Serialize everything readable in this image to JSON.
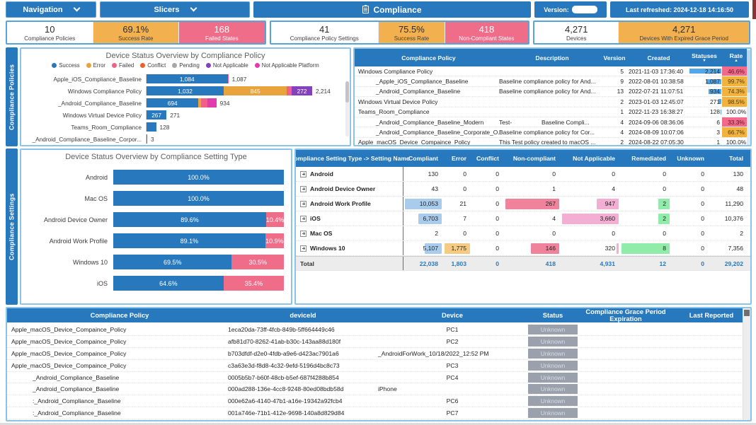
{
  "header": {
    "navigation_label": "Navigation",
    "slicers_label": "Slicers",
    "title": "Compliance",
    "version_label": "Version:",
    "last_refreshed": "Last refreshed: 2024-12-18 14:16:50"
  },
  "kpi_groups": [
    {
      "cards": [
        {
          "value": "10",
          "label": "Compliance Policies",
          "style": "white"
        },
        {
          "value": "69.1%",
          "label": "Success Rate",
          "style": "orange"
        },
        {
          "value": "168",
          "label": "Failed States",
          "style": "pink"
        }
      ]
    },
    {
      "cards": [
        {
          "value": "41",
          "label": "Compliance Policy Settings",
          "style": "white"
        },
        {
          "value": "75.5%",
          "label": "Success Rate",
          "style": "orange"
        },
        {
          "value": "418",
          "label": "Non-Compliant States",
          "style": "pink"
        }
      ]
    },
    {
      "cards": [
        {
          "value": "4,271",
          "label": "Devices",
          "style": "white"
        },
        {
          "value": "4,271",
          "label": "Devices With Expired Grace Period",
          "style": "orange"
        }
      ]
    }
  ],
  "side_tabs": {
    "top": "Compliance Policies",
    "bottom": "Compliance Settings"
  },
  "colors": {
    "primary": "#2878BE",
    "status": {
      "Success": "#2878BE",
      "Error": "#E8A33D",
      "Failed": "#EE6287",
      "Conflict": "#E8612C",
      "Pending": "#A6A6A6",
      "Not Applicable": "#8441BE",
      "Not Applicable Platform": "#E23BAE"
    },
    "databar": {
      "blue": "#A9CCEC",
      "orange": "#F5CB84",
      "pink": "#F0839B",
      "lpink": "#F3AED3",
      "green": "#90ECA8"
    },
    "rate": {
      "pink": "#F4698A",
      "orange": "#F2B33D"
    }
  },
  "chart_data": [
    {
      "type": "bar",
      "orientation": "horizontal",
      "stacked": true,
      "title": "Device Status Overview by Compliance Policy",
      "legend": [
        "Success",
        "Error",
        "Failed",
        "Conflict",
        "Pending",
        "Not Applicable",
        "Not Applicable Platform"
      ],
      "xmax": 2214,
      "rows": [
        {
          "label": "Apple_iOS_Compliance_Baseline",
          "total": 1087,
          "total_label": "1,087",
          "segments": [
            {
              "status": "Success",
              "value": 1084,
              "display": "1,084"
            },
            {
              "status": "Failed",
              "value": 3
            }
          ]
        },
        {
          "label": "Windows Compliance Policy",
          "total": 2214,
          "total_label": "2,214",
          "segments": [
            {
              "status": "Success",
              "value": 1032,
              "display": "1,032"
            },
            {
              "status": "Error",
              "value": 845,
              "display": "845"
            },
            {
              "status": "Failed",
              "value": 65
            },
            {
              "status": "Not Applicable",
              "value": 272,
              "display": "272"
            }
          ]
        },
        {
          "label": "_Android_Compliance_Baseline",
          "total": 934,
          "total_label": "934",
          "segments": [
            {
              "status": "Success",
              "value": 694,
              "display": "694"
            },
            {
              "status": "Error",
              "value": 30
            },
            {
              "status": "Failed",
              "value": 90
            },
            {
              "status": "Not Applicable Platform",
              "value": 120
            }
          ]
        },
        {
          "label": "Windows Virtual Device Policy",
          "total": 271,
          "total_label": "271",
          "segments": [
            {
              "status": "Success",
              "value": 267,
              "display": "267"
            }
          ]
        },
        {
          "label": "Teams_Room_Compliance",
          "total": 128,
          "total_label": "128",
          "segments": [
            {
              "status": "Success",
              "value": 128
            }
          ]
        },
        {
          "label": "_Android_Compliance_Baseline_Corpor...",
          "total": 3,
          "total_label": "3",
          "segments": [
            {
              "status": "Success",
              "value": 3
            }
          ]
        }
      ]
    },
    {
      "type": "bar",
      "orientation": "horizontal",
      "stacked": true,
      "units": "percent",
      "title": "Device Status Overview by Compliance Setting Type",
      "rows": [
        {
          "label": "Android",
          "success_pct": 100.0,
          "success_label": "100.0%",
          "failed_pct": 0,
          "failed_label": ""
        },
        {
          "label": "Mac OS",
          "success_pct": 100.0,
          "success_label": "100.0%",
          "failed_pct": 0,
          "failed_label": ""
        },
        {
          "label": "Android Device Owner",
          "success_pct": 89.6,
          "success_label": "89.6%",
          "failed_pct": 10.4,
          "failed_label": "10.4%"
        },
        {
          "label": "Android Work Profile",
          "success_pct": 89.1,
          "success_label": "89.1%",
          "failed_pct": 10.9,
          "failed_label": "10.9%"
        },
        {
          "label": "Windows 10",
          "success_pct": 69.5,
          "success_label": "69.5%",
          "failed_pct": 30.5,
          "failed_label": "30.5%"
        },
        {
          "label": "iOS",
          "success_pct": 64.6,
          "success_label": "64.6%",
          "failed_pct": 35.4,
          "failed_label": "35.4%"
        }
      ]
    }
  ],
  "policy_table": {
    "columns": [
      "Compliance Policy",
      "Description",
      "Version",
      "Created",
      "Statuses",
      "Rate"
    ],
    "sort": {
      "Statuses": "desc",
      "Rate": "asc"
    },
    "rows": [
      {
        "policy": "Windows Compliance Policy",
        "indent": false,
        "description": "",
        "version": "5",
        "created": "2021-11-03 17:36:40",
        "statuses": "2,214",
        "statuses_pct": 100,
        "rate": "46.6%",
        "rate_style": "pink"
      },
      {
        "policy": "_Apple_iOS_Compliance_Baseline",
        "indent": true,
        "description": "Baseline compliance policy for And...",
        "version": "9",
        "created": "2022-08-01 10:38:58",
        "statuses": "1,087",
        "statuses_pct": 49,
        "rate": "99.7%",
        "rate_style": "orange"
      },
      {
        "policy": "_Android_Compliance_Baseline",
        "indent": true,
        "description": "Baseline compliance policy for And...",
        "version": "13",
        "created": "2022-07-21 11:07:51",
        "statuses": "934",
        "statuses_pct": 42,
        "rate": "74.3%",
        "rate_style": "orange"
      },
      {
        "policy": "Windows Virtual Device Policy",
        "indent": false,
        "description": "",
        "version": "2",
        "created": "2023-01-03 12:45:07",
        "statuses": "271",
        "statuses_pct": 12,
        "rate": "98.5%",
        "rate_style": "orange"
      },
      {
        "policy": "Teams_Room_Compliance",
        "indent": false,
        "description": "",
        "version": "1",
        "created": "2022-11-23 16:38:27",
        "statuses": "128",
        "statuses_pct": 6,
        "rate": "100.0%",
        "rate_style": "none"
      },
      {
        "policy": "_Android_Compliance_Baseline_Modern",
        "indent": true,
        "description": "Test-                  Baseline Compli...",
        "version": "4",
        "created": "2024-09-06 08:36:06",
        "statuses": "6",
        "statuses_pct": 2,
        "rate": "33.3%",
        "rate_style": "pink"
      },
      {
        "policy": "_Android_Compliance_Baseline_Corporate_O...",
        "indent": true,
        "description": "Baseline compliance policy for Cor...",
        "version": "4",
        "created": "2024-08-09 10:07:06",
        "statuses": "3",
        "statuses_pct": 1.5,
        "rate": "66.7%",
        "rate_style": "orange"
      },
      {
        "policy": "Apple_macOS_Device_Compaince_Policy",
        "indent": false,
        "description": "This Test policy created to macOS ...",
        "version": "2",
        "created": "2024-08-22 07:05:30",
        "statuses": "1",
        "statuses_pct": 1,
        "rate": "100.0%",
        "rate_style": "none"
      }
    ]
  },
  "settings_table": {
    "header": "Compliance Setting Type -> Setting Name",
    "columns": [
      "Compliant",
      "Error",
      "Conflict",
      "Non-compliant",
      "Not Applicable",
      "Remediated",
      "Unknown",
      "Total"
    ],
    "rows": [
      {
        "name": "Android",
        "expandable": true,
        "cells": [
          {
            "v": "130",
            "bar": "blue",
            "pct": 4
          },
          {
            "v": "0"
          },
          {
            "v": "0"
          },
          {
            "v": "0"
          },
          {
            "v": "0"
          },
          {
            "v": "0"
          },
          {
            "v": "0"
          },
          {
            "v": "130"
          }
        ]
      },
      {
        "name": "Android Device Owner",
        "expandable": true,
        "cells": [
          {
            "v": "43",
            "bar": "blue",
            "pct": 3
          },
          {
            "v": "0"
          },
          {
            "v": "0"
          },
          {
            "v": "1",
            "bar": "pink",
            "pct": 3
          },
          {
            "v": "4",
            "bar": "lpink",
            "pct": 3
          },
          {
            "v": "0"
          },
          {
            "v": "0"
          },
          {
            "v": "48"
          }
        ]
      },
      {
        "name": "Android Work Profile",
        "expandable": true,
        "cells": [
          {
            "v": "10,053",
            "bar": "blue",
            "pct": 100
          },
          {
            "v": "21",
            "bar": "orange",
            "pct": 6
          },
          {
            "v": "0"
          },
          {
            "v": "267",
            "bar": "pink",
            "pct": 100
          },
          {
            "v": "947",
            "bar": "lpink",
            "pct": 42
          },
          {
            "v": "2",
            "bar": "green",
            "pct": 28
          },
          {
            "v": "0"
          },
          {
            "v": "11,290"
          }
        ]
      },
      {
        "name": "iOS",
        "expandable": true,
        "cells": [
          {
            "v": "6,703",
            "bar": "blue",
            "pct": 66
          },
          {
            "v": "7",
            "bar": "orange",
            "pct": 4
          },
          {
            "v": "0"
          },
          {
            "v": "4",
            "bar": "pink",
            "pct": 5
          },
          {
            "v": "3,660",
            "bar": "lpink",
            "pct": 100
          },
          {
            "v": "2",
            "bar": "green",
            "pct": 28
          },
          {
            "v": "0"
          },
          {
            "v": "10,376"
          }
        ]
      },
      {
        "name": "Mac OS",
        "expandable": true,
        "cells": [
          {
            "v": "2"
          },
          {
            "v": "0"
          },
          {
            "v": "0"
          },
          {
            "v": "0"
          },
          {
            "v": "0"
          },
          {
            "v": "0"
          },
          {
            "v": "0"
          },
          {
            "v": "2"
          }
        ]
      },
      {
        "name": "Windows 10",
        "expandable": true,
        "cells": [
          {
            "v": "5,107",
            "bar": "blue",
            "pct": 50
          },
          {
            "v": "1,775",
            "bar": "orange",
            "pct": 100
          },
          {
            "v": "0"
          },
          {
            "v": "146",
            "bar": "pink",
            "pct": 55
          },
          {
            "v": "320",
            "bar": "lpink",
            "pct": 8
          },
          {
            "v": "8",
            "bar": "green",
            "pct": 100
          },
          {
            "v": "0"
          },
          {
            "v": "7,356"
          }
        ]
      },
      {
        "name": "Total",
        "expandable": false,
        "is_total": true,
        "cells": [
          {
            "v": "22,038"
          },
          {
            "v": "1,803"
          },
          {
            "v": "0"
          },
          {
            "v": "418"
          },
          {
            "v": "4,931"
          },
          {
            "v": "12"
          },
          {
            "v": "0"
          },
          {
            "v": "29,202"
          }
        ]
      }
    ]
  },
  "device_table": {
    "columns": [
      "Compliance Policy",
      "deviceId",
      "Device",
      "Status",
      "Compliance Grace Period Expiration",
      "Last Reported"
    ],
    "rows": [
      {
        "policy": "Apple_macOS_Device_Compaince_Policy",
        "indent": false,
        "device_id": "1eca20da-73ff-4fcb-849b-5ff664449c46",
        "device": "PC1",
        "device_align": "center",
        "status": "Unknown"
      },
      {
        "policy": "Apple_macOS_Device_Compaince_Policy",
        "indent": false,
        "device_id": "afb81d70-8262-41ab-b30c-143aa88d180f",
        "device": "PC2",
        "device_align": "center",
        "status": "Unknown"
      },
      {
        "policy": "Apple_macOS_Device_Compaince_Policy",
        "indent": false,
        "device_id": "b703dfdf-d2e0-4fdb-a9e6-d423ac7901a6",
        "device": "_AndroidForWork_10/18/2022_12:52 PM",
        "device_align": "left",
        "status": "Unknown"
      },
      {
        "policy": "Apple_macOS_Device_Compaince_Policy",
        "indent": false,
        "device_id": "c3a63e3d-f8d8-4c32-9efd-5196d4bc8c73",
        "device": "PC3",
        "device_align": "center",
        "status": "Unknown"
      },
      {
        "policy": "_Android_Compliance_Baseline",
        "indent": true,
        "device_id": "0005b5b7-b60f-48cb-b5ef-687f4288b854",
        "device": "PC4",
        "device_align": "center",
        "status": "Unknown"
      },
      {
        "policy": "_Android_Compliance_Baseline",
        "indent": true,
        "device_id": "000ad288-136e-4cc8-9248-80ed08bdb58d",
        "device": "iPhone",
        "device_align": "left",
        "status": "Unknown"
      },
      {
        "policy": ":_Android_Compliance_Baseline",
        "indent": true,
        "device_id": "000e62a6-4140-47b1-a16e-19342a92fcb4",
        "device": "PC6",
        "device_align": "center",
        "status": "Unknown"
      },
      {
        "policy": ":_Android_Compliance_Baseline",
        "indent": true,
        "device_id": "001a746e-71b1-412e-9698-140a8d829d84",
        "device": "PC7",
        "device_align": "center",
        "status": "Unknown"
      }
    ]
  }
}
